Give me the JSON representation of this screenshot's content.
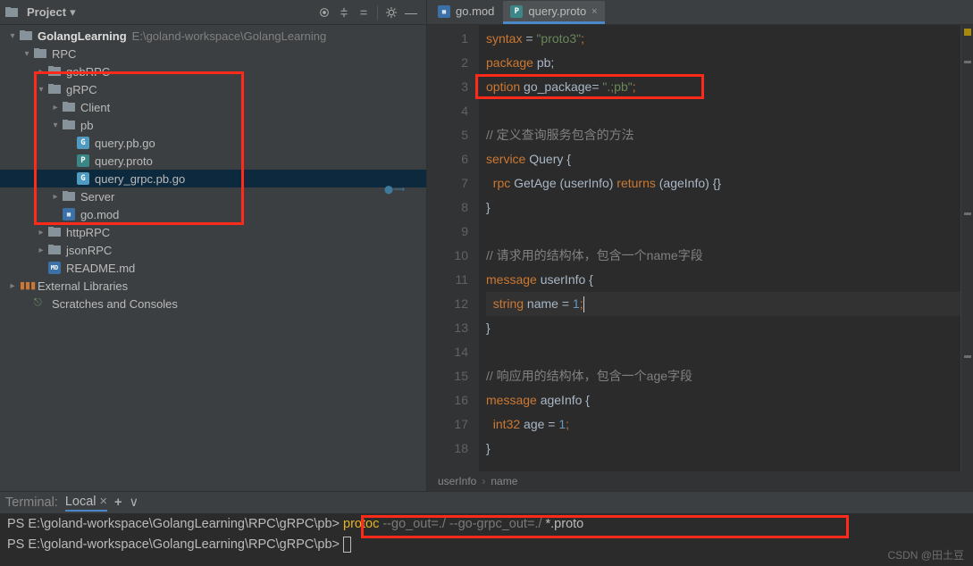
{
  "sidebar": {
    "header": {
      "title": "Project",
      "dropdown": "▾"
    },
    "toolbar_icons": [
      "target-icon",
      "collapse-all-icon",
      "settings-icon",
      "gear-icon",
      "hide-icon"
    ],
    "tree": {
      "root": {
        "name": "GolangLearning",
        "path": "E:\\goland-workspace\\GolangLearning"
      },
      "rpc": "RPC",
      "gobRPC": "gobRPC",
      "gRPC": "gRPC",
      "client": "Client",
      "pb": "pb",
      "q_pb_go": "query.pb.go",
      "q_proto": "query.proto",
      "q_grpc": "query_grpc.pb.go",
      "server": "Server",
      "go_mod": "go.mod",
      "httpRPC": "httpRPC",
      "jsonRPC": "jsonRPC",
      "readme": "README.md",
      "ext_lib": "External Libraries",
      "scratch": "Scratches and Consoles"
    }
  },
  "tabs": {
    "t1": "go.mod",
    "t2": "query.proto"
  },
  "code": {
    "gutter": [
      "1",
      "2",
      "3",
      "4",
      "5",
      "6",
      "7",
      "8",
      "9",
      "10",
      "11",
      "12",
      "13",
      "14",
      "15",
      "16",
      "17",
      "18"
    ],
    "l1a": "syntax",
    "l1b": " = ",
    "l1c": "\"proto3\"",
    "l1d": ";",
    "l2a": "package",
    "l2b": " pb;",
    "l3a": "option",
    "l3b": " go_package= ",
    "l3c": "\".;pb\"",
    "l3d": ";",
    "l5": "// 定义查询服务包含的方法",
    "l6a": "service",
    "l6b": " Query {",
    "l7a": "  rpc ",
    "l7b": "GetAge (userInfo) ",
    "l7c": "returns",
    "l7d": " (ageInfo) {}",
    "l8": "}",
    "l10": "// 请求用的结构体，包含一个name字段",
    "l11a": "message",
    "l11b": " userInfo {",
    "l12a": "  string",
    "l12b": " name = ",
    "l12c": "1",
    "l12d": ";",
    "l13": "}",
    "l15": "// 响应用的结构体，包含一个age字段",
    "l16a": "message",
    "l16b": " ageInfo {",
    "l17a": "  int32",
    "l17b": " age = ",
    "l17c": "1",
    "l17d": ";",
    "l18": "}"
  },
  "breadcrumb": {
    "b1": "userInfo",
    "b2": "name"
  },
  "terminal": {
    "label": "Terminal:",
    "tab": "Local",
    "l1_prompt": "PS E:\\goland-workspace\\GolangLearning\\RPC\\gRPC\\pb> ",
    "l1_cmd": "protoc",
    "l1_arg1": " --go_out=./ --go-grpc_out=./ ",
    "l1_arg2": "*.proto",
    "l2_prompt": "PS E:\\goland-workspace\\GolangLearning\\RPC\\gRPC\\pb> "
  },
  "watermark": "CSDN @田土豆"
}
